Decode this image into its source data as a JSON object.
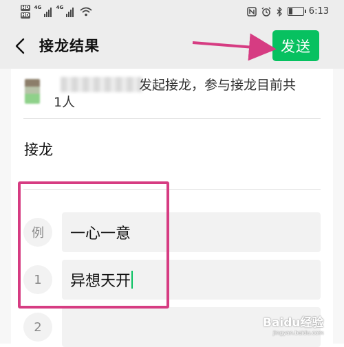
{
  "status_bar": {
    "hd_top": "HD",
    "hd_bottom": "HD",
    "network_1": "4G",
    "network_2": "4G",
    "time": "6:13",
    "battery_level": 0.3
  },
  "header": {
    "title": "接龙结果",
    "send_label": "发送"
  },
  "summary": {
    "text_line1": "发起接龙，参与接龙目前共",
    "text_line2": "1人"
  },
  "section": {
    "title": "接龙"
  },
  "entries": [
    {
      "number": "例",
      "value": "一心一意"
    },
    {
      "number": "1",
      "value": "异想天开"
    },
    {
      "number": "2",
      "value": ""
    }
  ],
  "colors": {
    "accent": "#07c160",
    "annotation": "#d63c82",
    "header_bg": "#ededed"
  },
  "watermark": {
    "brand": "Baidu经验",
    "sub": "jingyan.baidu.com"
  }
}
